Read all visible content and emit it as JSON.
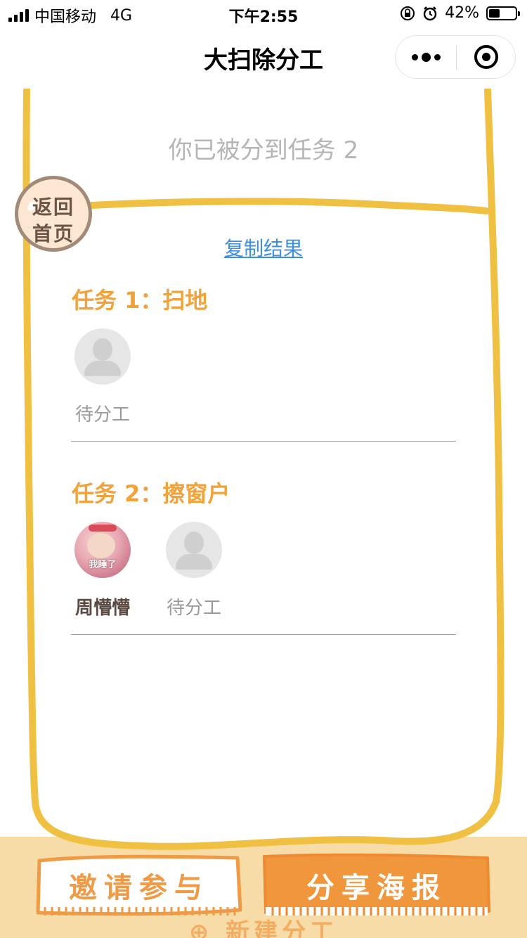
{
  "status_bar": {
    "carrier": "中国移动",
    "network": "4G",
    "time": "下午2:55",
    "battery_text": "42%",
    "battery_level": 0.42
  },
  "nav": {
    "title": "大扫除分工",
    "more_icon": "more-dots-icon",
    "close_icon": "target-circle-icon"
  },
  "card": {
    "subtitle": "你已被分到任务 2",
    "home_button": {
      "line1": "返回",
      "line2": "首页"
    },
    "copy_link": "复制结果",
    "tasks": [
      {
        "title": "任务 1：扫地",
        "members": [
          {
            "name": "待分工",
            "status": "pending",
            "avatar": "default-avatar-icon"
          }
        ]
      },
      {
        "title": "任务 2：擦窗户",
        "members": [
          {
            "name": "周懵懵",
            "status": "assigned",
            "avatar": "user-photo",
            "avatar_caption": "我睡了"
          },
          {
            "name": "待分工",
            "status": "pending",
            "avatar": "default-avatar-icon"
          }
        ]
      }
    ]
  },
  "bottom": {
    "invite_button": "邀请参与",
    "share_button": "分享海报",
    "new_task": "⊕ 新建分工"
  },
  "colors": {
    "frame": "#f0c043",
    "task_title": "#f2a23a",
    "link": "#3d8fe0",
    "share_button_bg": "#f0963c",
    "bottom_bg": "#f8dca8"
  }
}
